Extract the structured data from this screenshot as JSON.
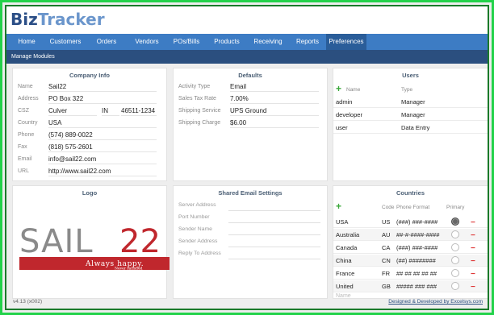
{
  "app": {
    "brand_part1": "Biz",
    "brand_part2": "Tracker"
  },
  "nav": {
    "items": [
      {
        "label": "Home"
      },
      {
        "label": "Customers"
      },
      {
        "label": "Orders"
      },
      {
        "label": "Vendors"
      },
      {
        "label": "POs/Bills"
      },
      {
        "label": "Products"
      },
      {
        "label": "Receiving"
      },
      {
        "label": "Reports"
      },
      {
        "label": "Preferences",
        "active": true
      }
    ]
  },
  "subnav": {
    "label": "Manage Modules"
  },
  "company": {
    "title": "Company Info",
    "name_label": "Name",
    "name": "Sail22",
    "address_label": "Address",
    "address": "PO Box 322",
    "csz_label": "CSZ",
    "city": "Culver",
    "state": "IN",
    "zip": "46511-1234",
    "country_label": "Country",
    "country": "USA",
    "phone_label": "Phone",
    "phone": "(574) 889-0022",
    "fax_label": "Fax",
    "fax": "(818) 575-2601",
    "email_label": "Email",
    "email": "info@sail22.com",
    "url_label": "URL",
    "url": "http://www.sail22.com"
  },
  "defaults": {
    "title": "Defaults",
    "activity_label": "Activity Type",
    "activity": "Email",
    "tax_label": "Sales Tax Rate",
    "tax": "7.00%",
    "shipping_label": "Shipping Service",
    "shipping": "UPS Ground",
    "charge_label": "Shipping Charge",
    "charge": "$6.00"
  },
  "users": {
    "title": "Users",
    "col_name": "Name",
    "col_type": "Type",
    "rows": [
      {
        "name": "admin",
        "type": "Manager"
      },
      {
        "name": "developer",
        "type": "Manager"
      },
      {
        "name": "user",
        "type": "Data Entry"
      }
    ]
  },
  "logo": {
    "title": "Logo",
    "text_left": "SAIL",
    "text_right": "22",
    "tagline": "Always happy.",
    "tagline_small": "Never satisfied",
    "colors": {
      "grey": "#8a8a8a",
      "red": "#c0272d"
    }
  },
  "email": {
    "title": "Shared Email Settings",
    "server_label": "Server Address",
    "port_label": "Port Number",
    "sender_name_label": "Sender Name",
    "sender_address_label": "Sender Address",
    "reply_label": "Reply To Address"
  },
  "countries": {
    "title": "Countries",
    "col_code": "Code",
    "col_format": "Phone Format",
    "col_primary": "Primary",
    "rows": [
      {
        "name": "USA",
        "code": "US",
        "format": "(###) ###-####",
        "primary": true
      },
      {
        "name": "Australia",
        "code": "AU",
        "format": "##-#-####-####",
        "primary": false
      },
      {
        "name": "Canada",
        "code": "CA",
        "format": "(###) ###-####",
        "primary": false
      },
      {
        "name": "China",
        "code": "CN",
        "format": "(##) ########",
        "primary": false
      },
      {
        "name": "France",
        "code": "FR",
        "format": "## ## ## ## ##",
        "primary": false
      },
      {
        "name": "United",
        "code": "GB",
        "format": "##### ### ###",
        "primary": false
      }
    ],
    "name_placeholder": "Name",
    "minus": "−",
    "plus": "+"
  },
  "footer": {
    "version": "v4.13 (x002)",
    "credit": "Designed & Developed by Excelsys.com"
  },
  "colors": {
    "nav": "#3d7cc4",
    "nav_active": "#2a5d99",
    "subnav": "#2b4f7f",
    "title": "#4a5e74",
    "add": "#3aa83a",
    "remove": "#d33333"
  }
}
